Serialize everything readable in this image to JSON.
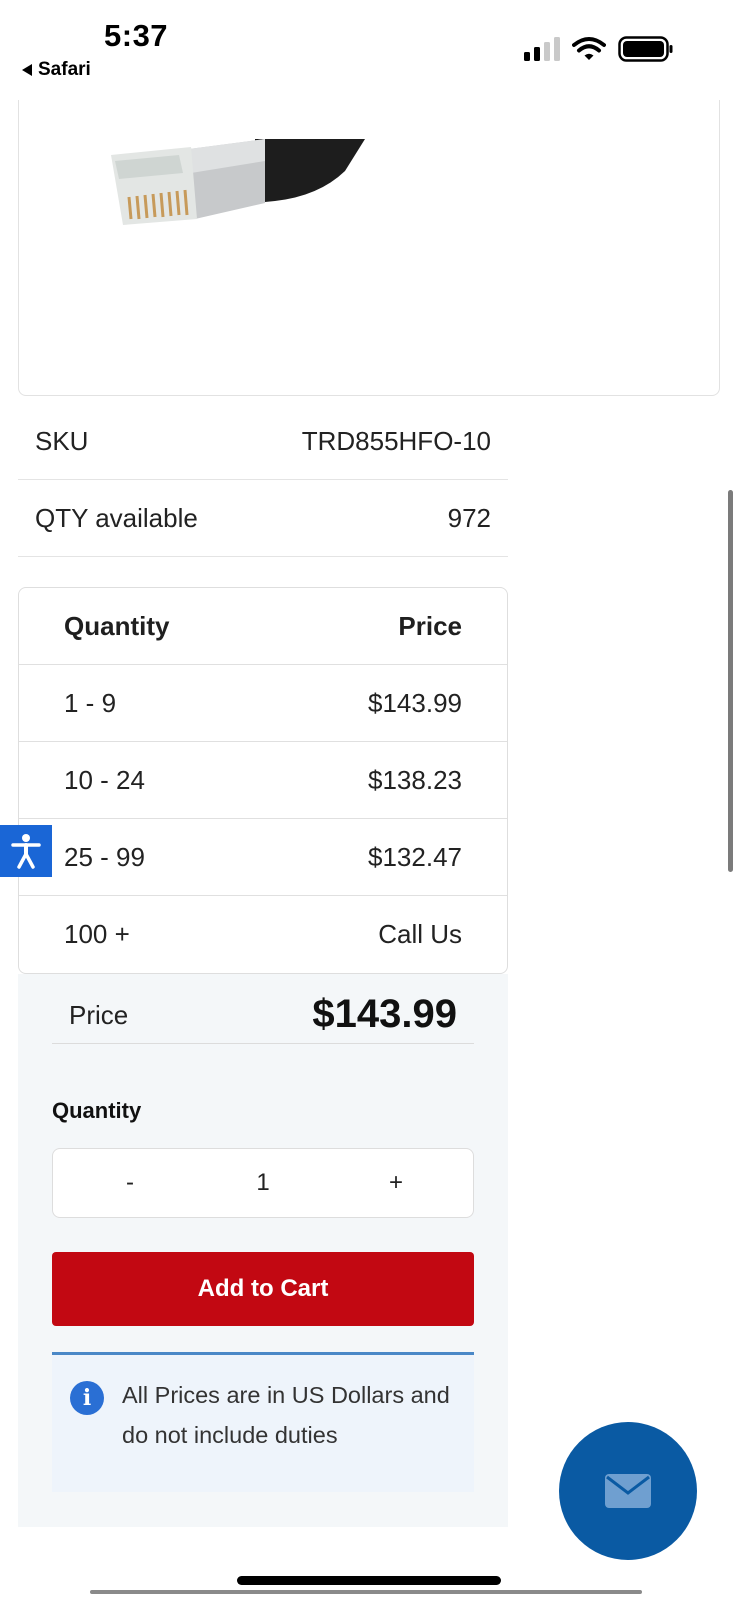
{
  "status_bar": {
    "time": "5:37",
    "back_app": "Safari"
  },
  "product": {
    "image_icon": "ethernet-connector-image"
  },
  "specs": [
    {
      "label": "SKU",
      "value": "TRD855HFO-10"
    },
    {
      "label": "QTY available",
      "value": "972"
    }
  ],
  "price_table": {
    "headers": {
      "quantity": "Quantity",
      "price": "Price"
    },
    "rows": [
      {
        "quantity": "1 - 9",
        "price": "$143.99"
      },
      {
        "quantity": "10 - 24",
        "price": "$138.23"
      },
      {
        "quantity": "25 - 99",
        "price": "$132.47"
      },
      {
        "quantity": "100 +",
        "price": "Call Us"
      }
    ]
  },
  "buy_box": {
    "price_label": "Price",
    "price_value": "$143.99",
    "quantity_label": "Quantity",
    "stepper": {
      "minus": "-",
      "value": "1",
      "plus": "+"
    },
    "add_to_cart": "Add to Cart",
    "notice": "All Prices are in US Dollars and do not include duties"
  },
  "colors": {
    "accent_red": "#c20812",
    "fab_blue": "#0a5aa3",
    "accessibility_blue": "#1a66d6",
    "notice_bg": "#eef4fb"
  },
  "icons": {
    "accessibility": "accessibility-icon",
    "chat": "mail-icon",
    "info": "info-icon"
  }
}
